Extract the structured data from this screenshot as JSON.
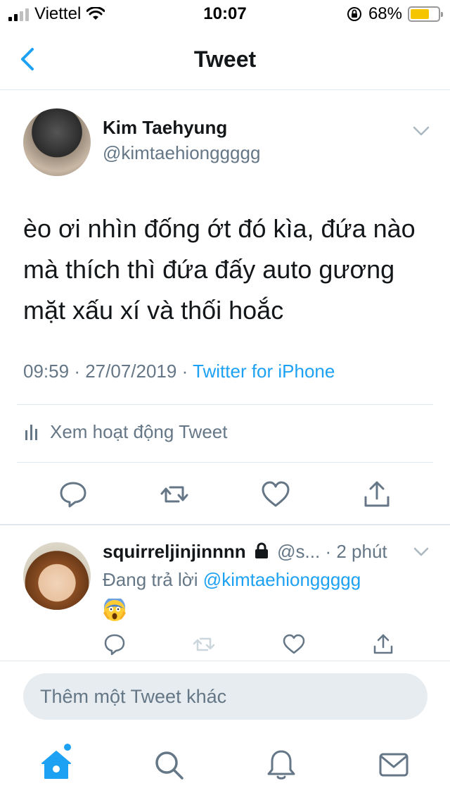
{
  "status_bar": {
    "carrier": "Viettel",
    "time": "10:07",
    "battery_percent": "68%",
    "battery_level": 0.68,
    "battery_color": "#f5c500",
    "icons": [
      "signal-icon",
      "wifi-icon",
      "orientation-lock-icon",
      "battery-icon"
    ]
  },
  "nav": {
    "title": "Tweet",
    "back_icon": "chevron-left-icon"
  },
  "tweet": {
    "author_name": "Kim Taehyung",
    "author_handle": "@kimtaehionggggg",
    "text": "èo ơi nhìn đống ớt đó kìa, đứa nào mà thích thì đứa đấy auto gương mặt xấu xí và thối hoắc",
    "time": "09:59",
    "date": "27/07/2019",
    "separator": "·",
    "source": "Twitter for iPhone",
    "activity_label": "Xem hoạt động Tweet",
    "actions": [
      "reply-icon",
      "retweet-icon",
      "like-icon",
      "share-icon"
    ]
  },
  "reply": {
    "name": "squirreljinjinnnn",
    "handle": "@s...",
    "separator": "·",
    "time": "2 phút",
    "replying_prefix": "Đang trả lời",
    "replying_to": "@kimtaehionggggg",
    "content_emoji": "😱"
  },
  "composer": {
    "placeholder": "Thêm một Tweet khác"
  },
  "tabbar": {
    "tabs": [
      "home-icon",
      "search-icon",
      "notifications-icon",
      "messages-icon"
    ],
    "home_has_dot": true
  },
  "colors": {
    "accent": "#1da1f2",
    "secondary_text": "#657786",
    "divider": "#e1e8ed"
  }
}
